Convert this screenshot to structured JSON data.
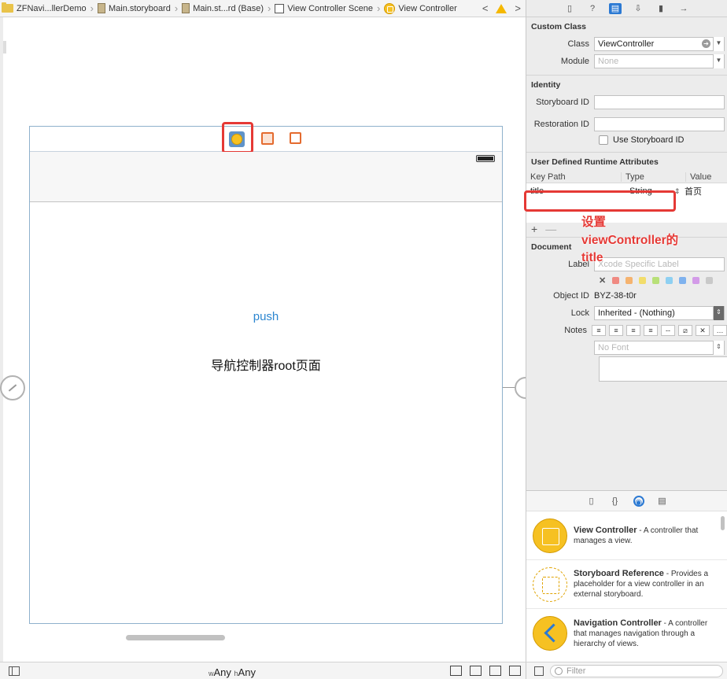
{
  "jumpbar": {
    "crumbs": [
      {
        "label": "ZFNavi...llerDemo",
        "icon": "folder-icon"
      },
      {
        "label": "Main.storyboard",
        "icon": "storyboard-file-icon"
      },
      {
        "label": "Main.st...rd (Base)",
        "icon": "storyboard-file-icon"
      },
      {
        "label": "View Controller Scene",
        "icon": "scene-icon"
      },
      {
        "label": "View Controller",
        "icon": "view-controller-icon"
      }
    ],
    "back": "<",
    "forward": ">"
  },
  "canvas": {
    "push_label": "push",
    "root_label": "导航控制器root页面",
    "battery_level": 1.0
  },
  "bottombar": {
    "size_w_prefix": "w",
    "size_w": "Any",
    "size_h_prefix": "h",
    "size_h": "Any"
  },
  "inspector": {
    "custom_class": {
      "title": "Custom Class",
      "class_label": "Class",
      "class_value": "ViewController",
      "module_label": "Module",
      "module_placeholder": "None"
    },
    "identity": {
      "title": "Identity",
      "storyboard_id_label": "Storyboard ID",
      "restoration_id_label": "Restoration ID",
      "use_storyboard_id_label": "Use Storyboard ID"
    },
    "runtime_attrs": {
      "title": "User Defined Runtime Attributes",
      "columns": [
        "Key Path",
        "Type",
        "Value"
      ],
      "rows": [
        {
          "key_path": "title",
          "type": "String",
          "value": "首页"
        }
      ],
      "add": "+",
      "remove": "—"
    },
    "annotation": {
      "line1": "设置",
      "line2": "viewController的",
      "line3": "title"
    },
    "document": {
      "title": "Document",
      "label_label": "Label",
      "label_placeholder": "Xcode Specific Label",
      "object_id_label": "Object ID",
      "object_id": "BYZ-38-t0r",
      "lock_label": "Lock",
      "lock_value": "Inherited - (Nothing)",
      "notes_label": "Notes",
      "font_placeholder": "No Font",
      "swatch_colors": [
        "#f08a82",
        "#f5b36f",
        "#f2dd6b",
        "#b8e078",
        "#8ed0f2",
        "#7fb2ee",
        "#d39be8",
        "#c9c9c9"
      ]
    }
  },
  "library": {
    "items": [
      {
        "name": "View Controller",
        "desc": " - A controller that manages a view.",
        "icon": "view-controller-icon"
      },
      {
        "name": "Storyboard Reference",
        "desc": " - Provides a placeholder for a view controller in an external storyboard.",
        "icon": "storyboard-reference-icon"
      },
      {
        "name": "Navigation Controller",
        "desc": " - A controller that manages navigation through a hierarchy of views.",
        "icon": "navigation-controller-icon"
      }
    ],
    "filter_placeholder": "Filter"
  }
}
